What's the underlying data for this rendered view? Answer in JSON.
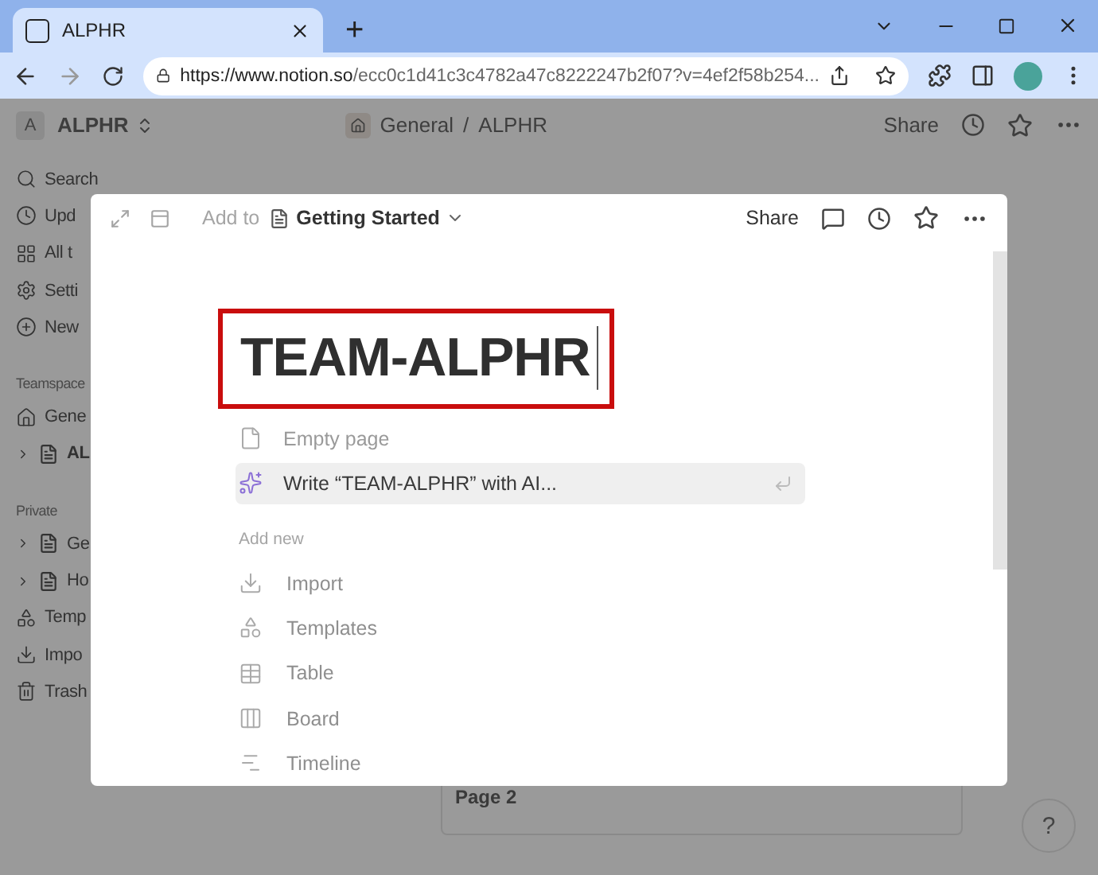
{
  "browser": {
    "tab_title": "ALPHR",
    "new_tab": "+",
    "url_host": "https://www.notion.so",
    "url_path": "/ecc0c1d41c3c4782a47c8222247b2f07?v=4ef2f58b254..."
  },
  "header": {
    "workspace_initial": "A",
    "workspace": "ALPHR",
    "breadcrumb": [
      "General",
      "ALPHR"
    ],
    "separator": "/",
    "share": "Share"
  },
  "sidebar": [
    {
      "kind": "item",
      "label": "Search"
    },
    {
      "kind": "item",
      "label": "Upd"
    },
    {
      "kind": "item",
      "label": "All t"
    },
    {
      "kind": "item",
      "label": "Setti"
    },
    {
      "kind": "item",
      "label": "New"
    },
    {
      "kind": "section",
      "label": "Teamspace"
    },
    {
      "kind": "item",
      "label": "Gene"
    },
    {
      "kind": "page",
      "label": "AL",
      "bold": true
    },
    {
      "kind": "section",
      "label": "Private"
    },
    {
      "kind": "page",
      "label": "Ge",
      "bold": false
    },
    {
      "kind": "page",
      "label": "Ho",
      "bold": false
    },
    {
      "kind": "item",
      "label": "Temp"
    },
    {
      "kind": "item",
      "label": "Impo"
    },
    {
      "kind": "item",
      "label": "Trash"
    }
  ],
  "background_card": {
    "title": "Page 2"
  },
  "help": "?",
  "modal": {
    "add_to": "Add to",
    "target": "Getting Started",
    "share": "Share",
    "title": "TEAM-ALPHR",
    "suggestions": [
      {
        "kind": "page",
        "label": "Empty page",
        "selected": false
      },
      {
        "kind": "ai",
        "label": "Write “TEAM-ALPHR” with AI...",
        "selected": true
      }
    ],
    "add_new_label": "Add new",
    "add_new": [
      {
        "label": "Import"
      },
      {
        "label": "Templates"
      },
      {
        "label": "Table"
      },
      {
        "label": "Board"
      },
      {
        "label": "Timeline"
      }
    ]
  }
}
